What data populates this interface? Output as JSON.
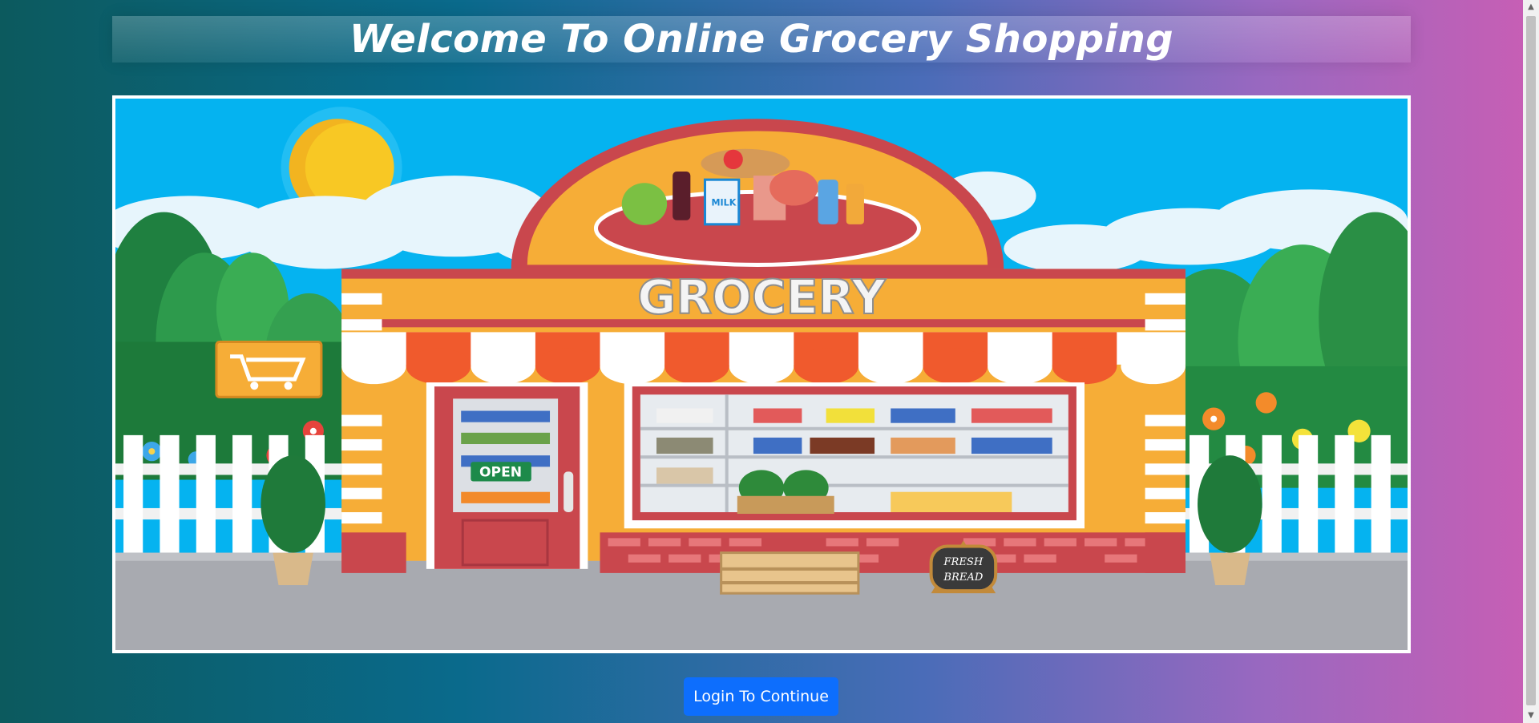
{
  "header": {
    "title": "Welcome To Online Grocery Shopping"
  },
  "hero": {
    "sign_text": "GROCERY",
    "door_sign": "OPEN",
    "board_line1": "FRESH",
    "board_line2": "BREAD",
    "milk_label": "MILK"
  },
  "actions": {
    "login_label": "Login To Continue"
  },
  "colors": {
    "button": "#0d6efd",
    "sky": "#05b3f0",
    "store": "#f6ad37",
    "awning": "#f05a2d"
  }
}
